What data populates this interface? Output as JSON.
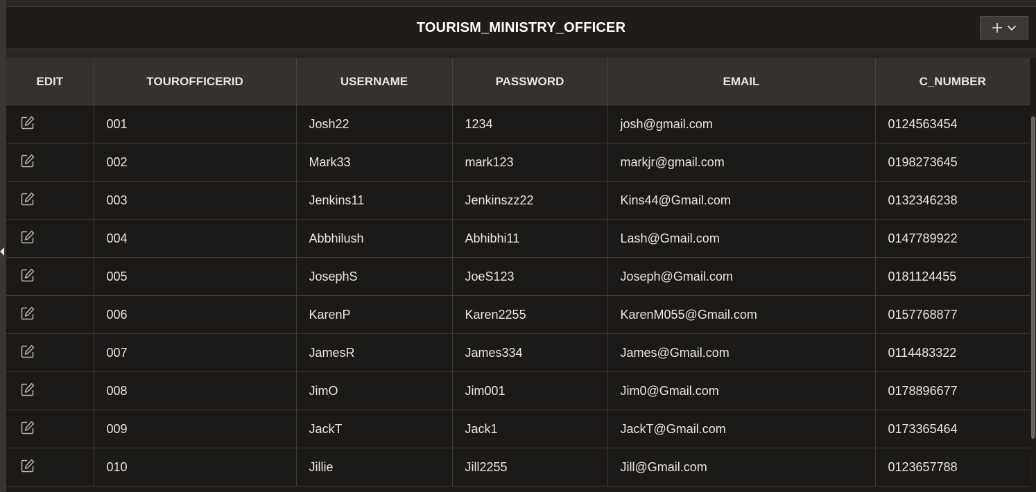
{
  "region": {
    "title": "TOURISM_MINISTRY_OFFICER",
    "add_button_icon": "plus-icon",
    "menu_icon": "chevron-down-icon"
  },
  "table": {
    "columns": [
      "EDIT",
      "TOUROFFICERID",
      "USERNAME",
      "PASSWORD",
      "EMAIL",
      "C_NUMBER"
    ],
    "rows": [
      {
        "id": "001",
        "username": "Josh22",
        "password": "1234",
        "email": "josh@gmail.com",
        "c_number": "0124563454"
      },
      {
        "id": "002",
        "username": "Mark33",
        "password": "mark123",
        "email": "markjr@gmail.com",
        "c_number": "0198273645"
      },
      {
        "id": "003",
        "username": "Jenkins11",
        "password": "Jenkinszz22",
        "email": "Kins44@Gmail.com",
        "c_number": "0132346238"
      },
      {
        "id": "004",
        "username": "Abbhilush",
        "password": "Abhibhi11",
        "email": "Lash@Gmail.com",
        "c_number": "0147789922"
      },
      {
        "id": "005",
        "username": "JosephS",
        "password": "JoeS123",
        "email": "Joseph@Gmail.com",
        "c_number": "0181124455"
      },
      {
        "id": "006",
        "username": "KarenP",
        "password": "Karen2255",
        "email": "KarenM055@Gmail.com",
        "c_number": "0157768877"
      },
      {
        "id": "007",
        "username": "JamesR",
        "password": "James334",
        "email": "James@Gmail.com",
        "c_number": "0114483322"
      },
      {
        "id": "008",
        "username": "JimO",
        "password": "Jim001",
        "email": "Jim0@Gmail.com",
        "c_number": "0178896677"
      },
      {
        "id": "009",
        "username": "JackT",
        "password": "Jack1",
        "email": "JackT@Gmail.com",
        "c_number": "0173365464"
      },
      {
        "id": "010",
        "username": "Jillie",
        "password": "Jill2255",
        "email": "Jill@Gmail.com",
        "c_number": "0123657788"
      }
    ]
  },
  "colors": {
    "background": "#1f1c1a",
    "header_bg": "#35312d",
    "text": "#eae6e1"
  }
}
